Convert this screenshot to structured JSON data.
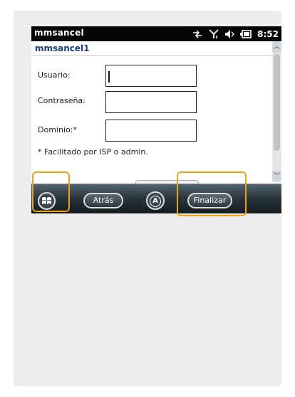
{
  "statusbar": {
    "app_name": "mmsancel",
    "time": "8:52",
    "icons": [
      "data-connection-icon",
      "signal-strength-icon",
      "volume-icon",
      "battery-icon"
    ]
  },
  "window": {
    "title": "mmsancel1"
  },
  "form": {
    "user_label": "Usuario:",
    "user_value": "",
    "password_label": "Contraseña:",
    "password_value": "",
    "domain_label": "Dominio:*",
    "domain_value": "",
    "note": "* Facilitado por ISP o admin."
  },
  "softkeys": {
    "back_label": "Atrás",
    "keyboard_label": "A",
    "finish_label": "Finalizar"
  },
  "colors": {
    "highlight": "#f0a10a",
    "title_text": "#1b3c7a",
    "statusbar_bg": "#050505"
  }
}
